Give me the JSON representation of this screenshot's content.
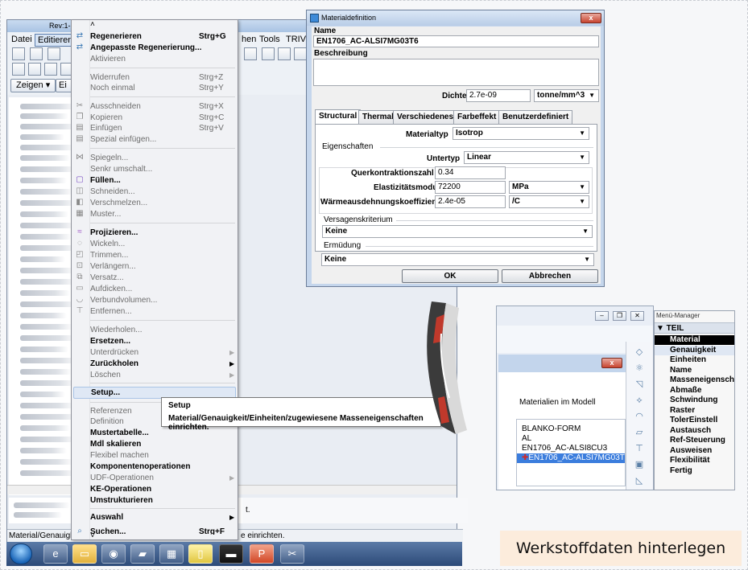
{
  "bg_window": {
    "title": "Rev:1-1",
    "menus": [
      "Datei",
      "Editieren",
      "hen",
      "Tools",
      "TRIVI"
    ],
    "zeigen_button": "Zeigen ▾",
    "ein_button": "Ei",
    "status_text": "Material/Genauigk",
    "status_text_right": "e einrichten.",
    "msg_right": "t."
  },
  "context_menu": {
    "top_arrow": "˄",
    "bottom_arrow": "˅",
    "items": [
      {
        "label": "Regenerieren",
        "shortcut": "Strg+G",
        "enabled": true
      },
      {
        "label": "Angepasste Regenerierung...",
        "shortcut": "",
        "enabled": true
      },
      {
        "label": "Aktivieren",
        "shortcut": "",
        "enabled": false
      },
      {
        "label": "Widerrufen",
        "shortcut": "Strg+Z",
        "enabled": false
      },
      {
        "label": "Noch einmal",
        "shortcut": "Strg+Y",
        "enabled": false
      },
      {
        "label": "Ausschneiden",
        "shortcut": "Strg+X",
        "enabled": false
      },
      {
        "label": "Kopieren",
        "shortcut": "Strg+C",
        "enabled": false
      },
      {
        "label": "Einfügen",
        "shortcut": "Strg+V",
        "enabled": false
      },
      {
        "label": "Spezial einfügen...",
        "shortcut": "",
        "enabled": false
      },
      {
        "label": "Spiegeln...",
        "shortcut": "",
        "enabled": false
      },
      {
        "label": "Senkr umschalt...",
        "shortcut": "",
        "enabled": false
      },
      {
        "label": "Füllen...",
        "shortcut": "",
        "enabled": true
      },
      {
        "label": "Schneiden...",
        "shortcut": "",
        "enabled": false
      },
      {
        "label": "Verschmelzen...",
        "shortcut": "",
        "enabled": false
      },
      {
        "label": "Muster...",
        "shortcut": "",
        "enabled": false
      },
      {
        "label": "Projizieren...",
        "shortcut": "",
        "enabled": true
      },
      {
        "label": "Wickeln...",
        "shortcut": "",
        "enabled": false
      },
      {
        "label": "Trimmen...",
        "shortcut": "",
        "enabled": false
      },
      {
        "label": "Verlängern...",
        "shortcut": "",
        "enabled": false
      },
      {
        "label": "Versatz...",
        "shortcut": "",
        "enabled": false
      },
      {
        "label": "Aufdicken...",
        "shortcut": "",
        "enabled": false
      },
      {
        "label": "Verbundvolumen...",
        "shortcut": "",
        "enabled": false
      },
      {
        "label": "Entfernen...",
        "shortcut": "",
        "enabled": false
      },
      {
        "label": "Wiederholen...",
        "shortcut": "",
        "enabled": false
      },
      {
        "label": "Ersetzen...",
        "shortcut": "",
        "enabled": true
      },
      {
        "label": "Unterdrücken",
        "shortcut": "",
        "enabled": false
      },
      {
        "label": "Zurückholen",
        "shortcut": "",
        "enabled": true
      },
      {
        "label": "Löschen",
        "shortcut": "",
        "enabled": false
      },
      {
        "label": "Setup...",
        "shortcut": "",
        "enabled": true
      },
      {
        "label": "Referenzen",
        "shortcut": "",
        "enabled": false
      },
      {
        "label": "Definition",
        "shortcut": "",
        "enabled": false
      },
      {
        "label": "Mustertabelle...",
        "shortcut": "",
        "enabled": true
      },
      {
        "label": "Mdl skalieren",
        "shortcut": "",
        "enabled": true
      },
      {
        "label": "Flexibel machen",
        "shortcut": "",
        "enabled": false
      },
      {
        "label": "Komponentenoperationen",
        "shortcut": "",
        "enabled": true
      },
      {
        "label": "UDF-Operationen",
        "shortcut": "",
        "enabled": false
      },
      {
        "label": "KE-Operationen",
        "shortcut": "",
        "enabled": true
      },
      {
        "label": "Umstrukturieren",
        "shortcut": "",
        "enabled": true
      },
      {
        "label": "Auswahl",
        "shortcut": "",
        "enabled": true
      },
      {
        "label": "Suchen...",
        "shortcut": "Strg+F",
        "enabled": true
      }
    ]
  },
  "tooltip": {
    "title": "Setup",
    "text": "Material/Genauigkeit/Einheiten/zugewiesene Masseneigenschaften einrichten."
  },
  "material_dialog": {
    "title": "Materialdefinition",
    "close": "x",
    "name_label": "Name",
    "name_value": "EN1706_AC-ALSI7MG03T6",
    "beschreibung_label": "Beschreibung",
    "dichte_label": "Dichte",
    "dichte_value": "2.7e-09",
    "dichte_unit": "tonne/mm^3",
    "tabs": [
      "Structural",
      "Thermal",
      "Verschiedenes",
      "Farbeffekt",
      "Benutzerdefiniert"
    ],
    "materialtyp_label": "Materialtyp",
    "materialtyp_value": "Isotrop",
    "eigenschaften_label": "Eigenschaften",
    "untertyp_label": "Untertyp",
    "untertyp_value": "Linear",
    "querkontraktion_label": "Querkontraktionszahl",
    "querkontraktion_value": "0.34",
    "emodul_label": "Elastizitätsmodul",
    "emodul_value": "72200",
    "emodul_unit": "MPa",
    "waerme_label": "Wärmeausdehnungskoeffizient",
    "waerme_value": "2.4e-05",
    "waerme_unit": "/C",
    "versagen_label": "Versagenskriterium",
    "versagen_value": "Keine",
    "ermuedung_label": "Ermüdung",
    "ermuedung_value": "Keine",
    "ok_label": "OK",
    "abbrechen_label": "Abbrechen"
  },
  "materials_model": {
    "heading": "Materialien im Modell",
    "close": "x",
    "items": [
      "BLANKO-FORM",
      "AL",
      "EN1706_AC-ALSI8CU3",
      "EN1706_AC-ALSI7MG03T"
    ],
    "selected_index": 3
  },
  "menu_manager": {
    "title": "Menü-Manager",
    "header": "▼ TEIL EINRICHTEN",
    "items": [
      "Material",
      "Genauigkeit",
      "Einheiten",
      "Name",
      "Masseneigensch",
      "Abmaße",
      "Schwindung",
      "Raster",
      "TolerEinstell",
      "Austausch",
      "Ref-Steuerung",
      "Ausweisen",
      "Flexibilität",
      "Fertig"
    ]
  },
  "caption": "Werkstoffdaten hinterlegen"
}
